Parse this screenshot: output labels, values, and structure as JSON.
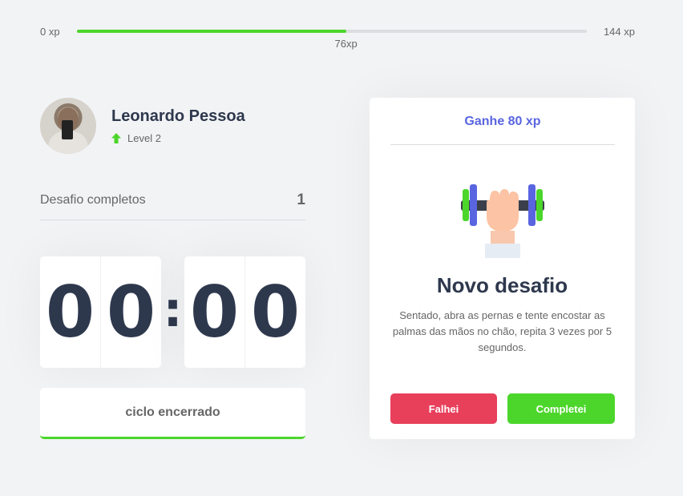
{
  "xp": {
    "min_label": "0 xp",
    "max_label": "144 xp",
    "current_label": "76xp",
    "current": 76,
    "max": 144
  },
  "profile": {
    "name": "Leonardo Pessoa",
    "level": "Level 2"
  },
  "completed": {
    "label": "Desafio completos",
    "value": "1"
  },
  "countdown": {
    "minute_left": "0",
    "minute_right": "0",
    "second_left": "0",
    "second_right": "0",
    "separator": ":"
  },
  "cycle_button": {
    "label": "ciclo encerrado"
  },
  "challenge": {
    "reward": "Ganhe 80 xp",
    "title": "Novo desafio",
    "description": "Sentado, abra as pernas e tente encostar as palmas das mãos no chão, repita 3 vezes por 5 segundos.",
    "icon": "dumbbell-icon",
    "fail_label": "Falhei",
    "success_label": "Completei"
  },
  "colors": {
    "green": "#4cd62b",
    "red": "#e83f5b",
    "blue": "#5965e0",
    "title": "#2e384d"
  }
}
